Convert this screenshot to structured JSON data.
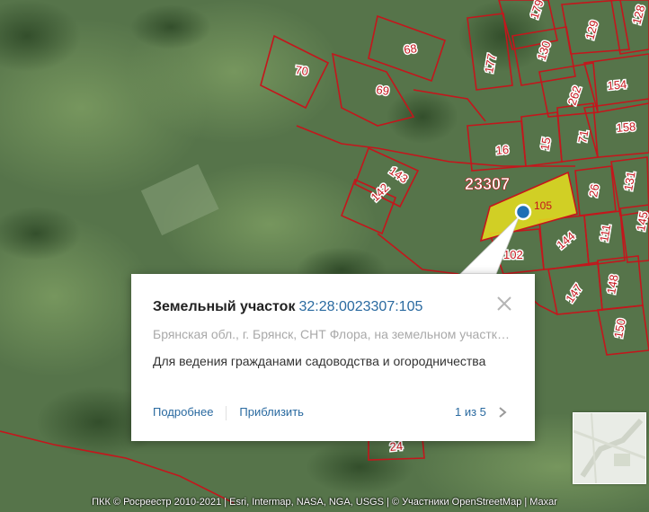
{
  "map": {
    "block_label": "23307",
    "selected_parcel": "105",
    "parcels": [
      {
        "label": "179"
      },
      {
        "label": "128"
      },
      {
        "label": "130"
      },
      {
        "label": "129"
      },
      {
        "label": "68"
      },
      {
        "label": "177"
      },
      {
        "label": "70"
      },
      {
        "label": "154"
      },
      {
        "label": "69"
      },
      {
        "label": "262"
      },
      {
        "label": "158"
      },
      {
        "label": "16"
      },
      {
        "label": "15"
      },
      {
        "label": "71"
      },
      {
        "label": "143"
      },
      {
        "label": "142"
      },
      {
        "label": "131"
      },
      {
        "label": "26"
      },
      {
        "label": "145"
      },
      {
        "label": "111"
      },
      {
        "label": "144"
      },
      {
        "label": "102"
      },
      {
        "label": "147"
      },
      {
        "label": "148"
      },
      {
        "label": "150"
      },
      {
        "label": "24"
      }
    ]
  },
  "popup": {
    "title": "Земельный участок",
    "cadastral_number": "32:28:0023307:105",
    "address": "Брянская обл., г. Брянск, СНТ Флора, на земельном участке расположен",
    "purpose": "Для ведения гражданами садоводства и огородничества",
    "link_details": "Подробнее",
    "link_zoom": "Приблизить",
    "pager": "1 из 5"
  },
  "attribution": "ПКК © Росреестр 2010-2021 | Esri, Intermap, NASA, NGA, USGS | © Участники OpenStreetMap | Maxar",
  "colors": {
    "parcel_border": "#c4161c",
    "parcel_label": "#c4161c",
    "selected_fill": "#e6df1f",
    "marker": "#1f6fb5",
    "link": "#2a6aa0"
  }
}
